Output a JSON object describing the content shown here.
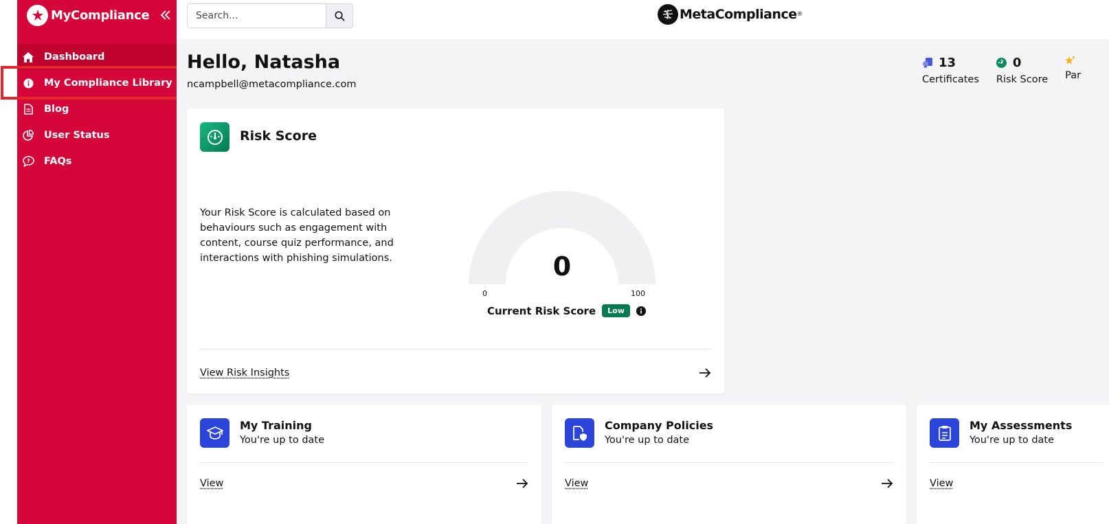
{
  "sidebar": {
    "brand": "MyCompliance",
    "items": [
      {
        "label": "Dashboard",
        "icon": "home-icon"
      },
      {
        "label": "My Compliance Library",
        "icon": "info-icon"
      },
      {
        "label": "Blog",
        "icon": "document-icon"
      },
      {
        "label": "User Status",
        "icon": "pie-chart-icon"
      },
      {
        "label": "FAQs",
        "icon": "chat-question-icon"
      }
    ],
    "active_index": 0
  },
  "header": {
    "search_placeholder": "Search...",
    "logo_text": "MetaCompliance",
    "logo_mark": "®"
  },
  "greeting": {
    "hello": "Hello, Natasha",
    "email": "ncampbell@metacompliance.com"
  },
  "stats": [
    {
      "value": "13",
      "label": "Certificates",
      "icon": "certificate-icon",
      "color": "#4a5bd8"
    },
    {
      "value": "0",
      "label": "Risk Score",
      "icon": "gauge-icon",
      "color": "#0a8a5c"
    },
    {
      "value": "",
      "label": "Par",
      "icon": "star-icon",
      "color": "#f5b41a"
    }
  ],
  "risk_card": {
    "title": "Risk Score",
    "description": "Your Risk Score is calculated based on behaviours such as engagement with content, course quiz performance, and interactions with phishing simulations.",
    "score": "0",
    "min_label": "0",
    "max_label": "100",
    "gauge_fraction": 0,
    "current_label": "Current Risk Score",
    "level": "Low",
    "link": "View Risk Insights"
  },
  "cards": [
    {
      "title": "My Training",
      "subtitle": "You're up to date",
      "link": "View",
      "icon": "graduation-cap-icon"
    },
    {
      "title": "Company Policies",
      "subtitle": "You're up to date",
      "link": "View",
      "icon": "policy-shield-icon"
    },
    {
      "title": "My Assessments",
      "subtitle": "You're up to date",
      "link": "View",
      "icon": "clipboard-icon"
    }
  ],
  "colors": {
    "sidebar": "#d4063a",
    "highlight": "#e3262c",
    "risk_green": "#067a52",
    "card_blue": "#2b44d9"
  }
}
